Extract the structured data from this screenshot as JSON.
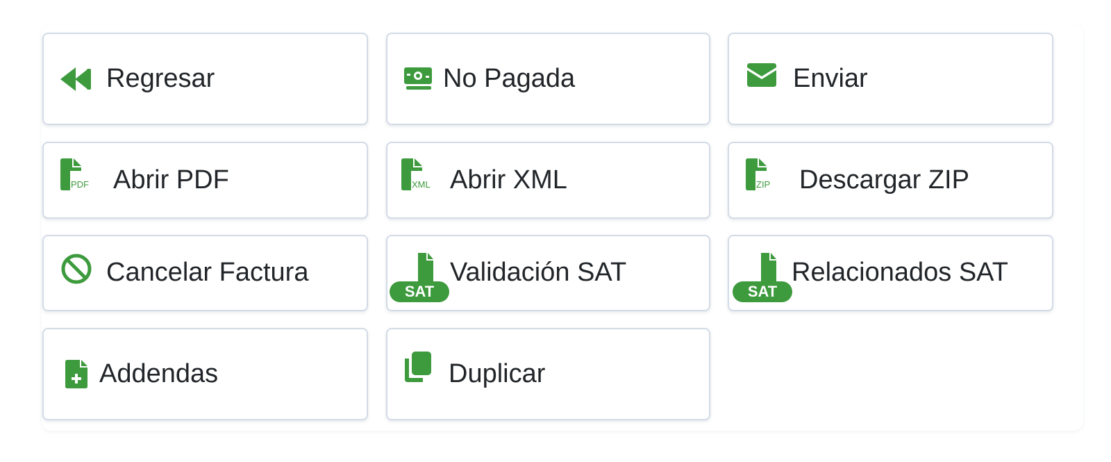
{
  "accent_color": "#3d9a3d",
  "buttons": {
    "regresar": {
      "label": "Regresar",
      "icon": "backward-icon"
    },
    "no_pagada": {
      "label": "No Pagada",
      "icon": "money-bill-icon"
    },
    "enviar": {
      "label": "Enviar",
      "icon": "envelope-icon"
    },
    "abrir_pdf": {
      "label": "Abrir PDF",
      "icon": "file-pdf-icon",
      "icon_text": "PDF"
    },
    "abrir_xml": {
      "label": "Abrir XML",
      "icon": "file-xml-icon",
      "icon_text": "XML"
    },
    "descargar_zip": {
      "label": "Descargar ZIP",
      "icon": "file-zip-icon",
      "icon_text": "ZIP"
    },
    "cancelar_factura": {
      "label": "Cancelar Factura",
      "icon": "ban-icon"
    },
    "validacion_sat": {
      "label": "Validación SAT",
      "icon": "file-sat-icon",
      "badge": "SAT"
    },
    "relacionados_sat": {
      "label": "Relacionados SAT",
      "icon": "file-sat-icon",
      "badge": "SAT"
    },
    "addendas": {
      "label": "Addendas",
      "icon": "file-plus-icon"
    },
    "duplicar": {
      "label": "Duplicar",
      "icon": "copy-icon"
    }
  }
}
